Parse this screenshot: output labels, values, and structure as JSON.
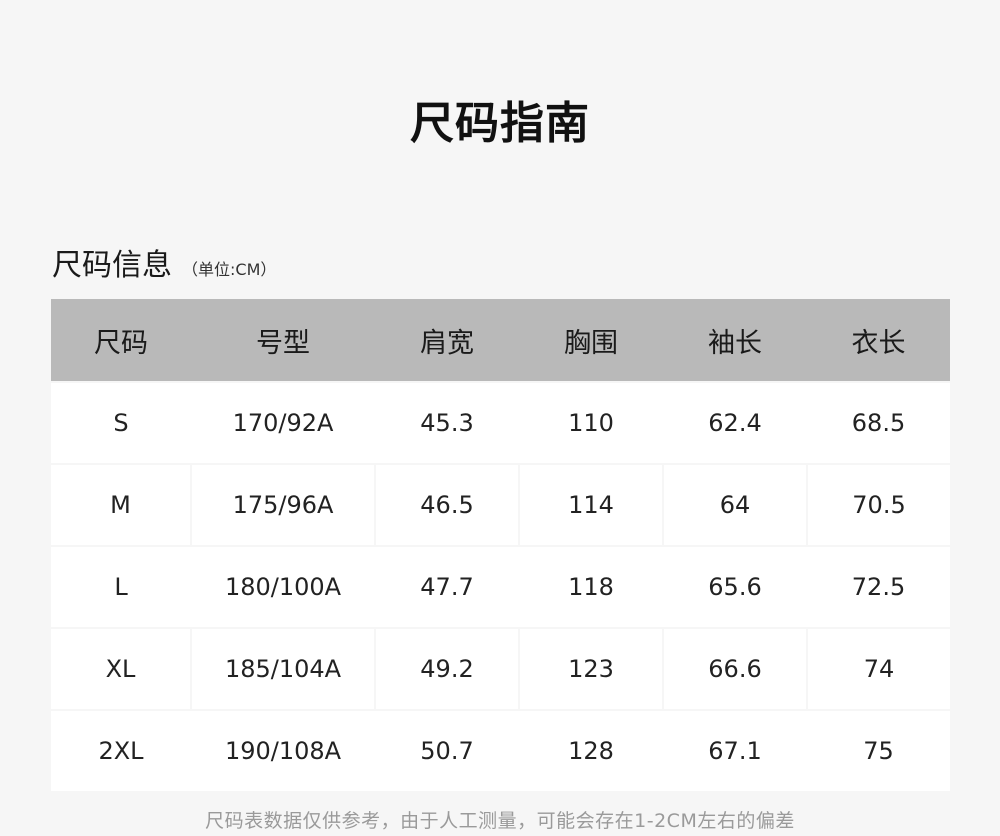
{
  "page": {
    "title": "尺码指南"
  },
  "section": {
    "title": "尺码信息",
    "unit": "（单位:CM）"
  },
  "table": {
    "headers": [
      "尺码",
      "号型",
      "肩宽",
      "胸围",
      "袖长",
      "衣长"
    ],
    "rows": [
      [
        "S",
        "170/92A",
        "45.3",
        "110",
        "62.4",
        "68.5"
      ],
      [
        "M",
        "175/96A",
        "46.5",
        "114",
        "64",
        "70.5"
      ],
      [
        "L",
        "180/100A",
        "47.7",
        "118",
        "65.6",
        "72.5"
      ],
      [
        "XL",
        "185/104A",
        "49.2",
        "123",
        "66.6",
        "74"
      ],
      [
        "2XL",
        "190/108A",
        "50.7",
        "128",
        "67.1",
        "75"
      ]
    ]
  },
  "footnote": "尺码表数据仅供参考，由于人工测量，可能会存在1-2CM左右的偏差"
}
